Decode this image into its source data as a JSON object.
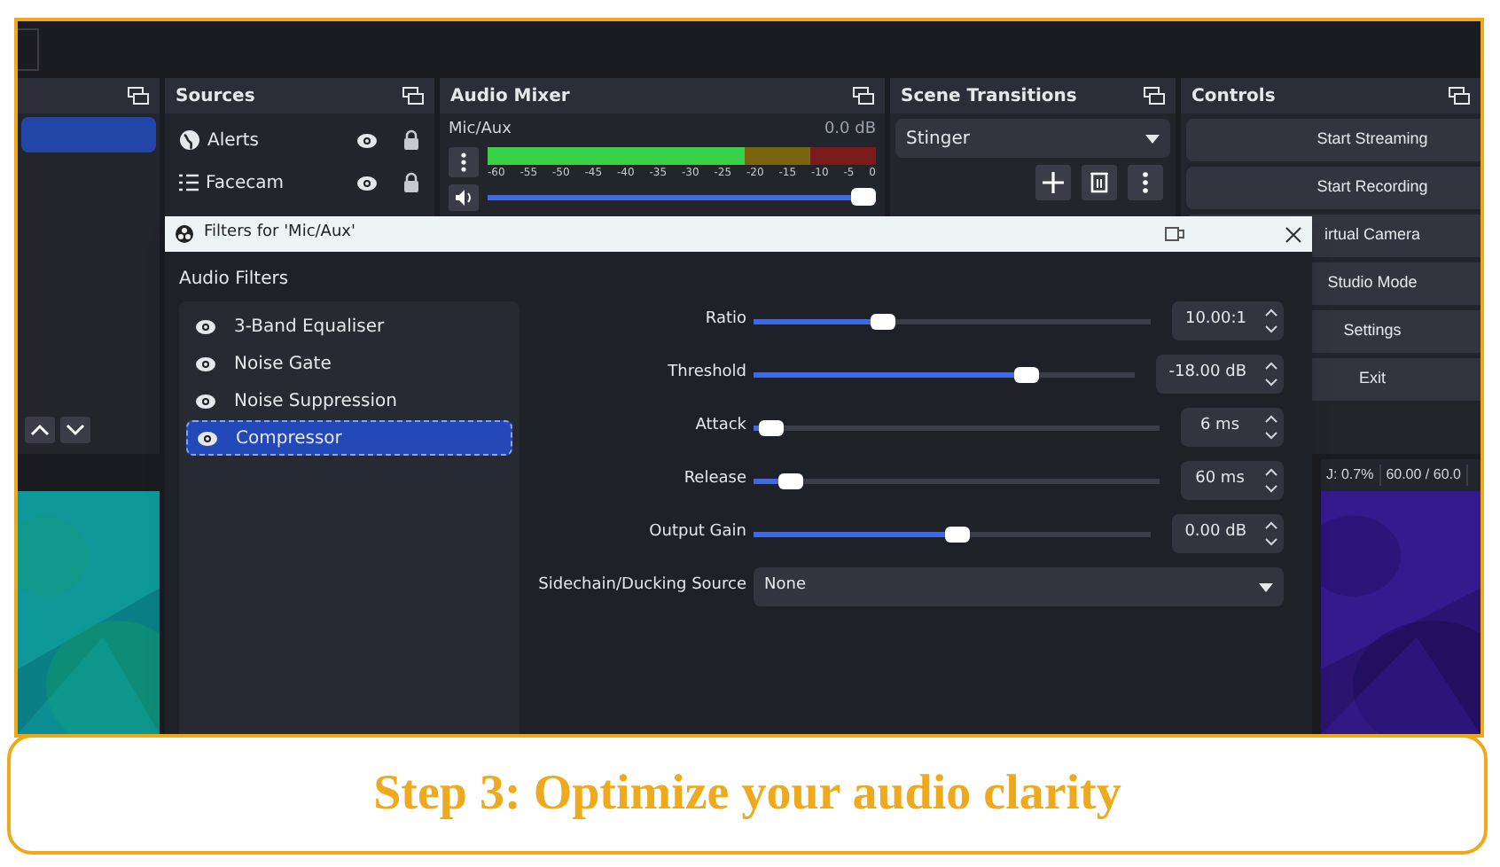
{
  "scenes": {
    "items": [
      {
        "selected": true
      }
    ]
  },
  "sources": {
    "title": "Sources",
    "items": [
      {
        "name": "Alerts",
        "kind": "browser"
      },
      {
        "name": "Facecam",
        "kind": "list"
      }
    ]
  },
  "audio_mixer": {
    "title": "Audio Mixer",
    "channel": "Mic/Aux",
    "reading": "0.0 dB",
    "meter": {
      "level": 0.66
    },
    "ticks": [
      "-60",
      "-55",
      "-50",
      "-45",
      "-40",
      "-35",
      "-30",
      "-25",
      "-20",
      "-15",
      "-10",
      "-5",
      "0"
    ],
    "volume": {
      "level": 1
    }
  },
  "scene_transitions": {
    "title": "Scene Transitions",
    "value": "Stinger"
  },
  "controls": {
    "title": "Controls",
    "buttons": [
      "Start Streaming",
      "Start Recording",
      "irtual Camera",
      "Studio Mode",
      "Settings",
      "Exit"
    ]
  },
  "stats": [
    "J: 0.7%",
    "60.00 / 60.0"
  ],
  "filters_dialog": {
    "title": "Filters for 'Mic/Aux'",
    "section": "Audio Filters",
    "filters": [
      {
        "name": "3-Band Equaliser",
        "selected": false
      },
      {
        "name": "Noise Gate",
        "selected": false
      },
      {
        "name": "Noise Suppression",
        "selected": false
      },
      {
        "name": "Compressor",
        "selected": true
      }
    ],
    "properties": [
      {
        "kind": "slider",
        "label": "Ratio",
        "level": 0.31,
        "value": "10.00:1"
      },
      {
        "kind": "slider",
        "label": "Threshold",
        "level": 0.7,
        "value": "-18.00 dB"
      },
      {
        "kind": "slider",
        "label": "Attack",
        "level": 0.03,
        "value": "6 ms"
      },
      {
        "kind": "slider",
        "label": "Release",
        "level": 0.08,
        "value": "60 ms"
      },
      {
        "kind": "slider",
        "label": "Output Gain",
        "level": 0.5,
        "value": "0.00 dB"
      },
      {
        "kind": "select",
        "label": "Sidechain/Ducking Source",
        "value": "None"
      }
    ]
  },
  "caption": "Step 3: Optimize your audio clarity"
}
